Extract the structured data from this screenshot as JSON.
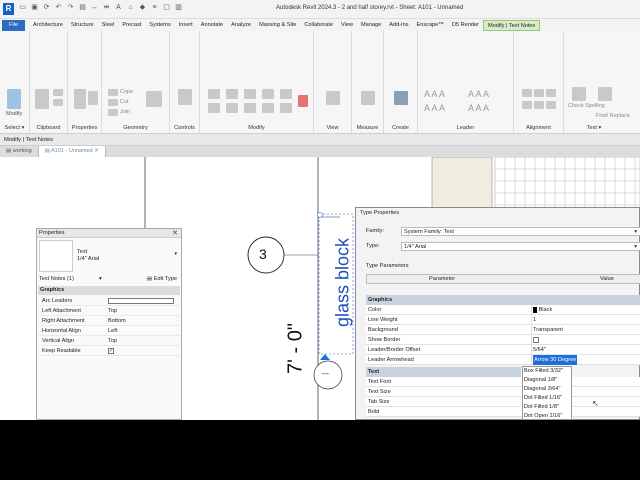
{
  "window": {
    "app_logo": "R",
    "title": "Autodesk Revit 2024.3 - 2 and half storey.rvt - Sheet: A101 - Unnamed"
  },
  "ribbon_tabs": [
    "File",
    "Architecture",
    "Structure",
    "Steel",
    "Precast",
    "Systems",
    "Insert",
    "Annotate",
    "Analyze",
    "Massing & Site",
    "Collaborate",
    "View",
    "Manage",
    "Add-Ins",
    "Enscape™",
    "D5 Render",
    "Modify | Text Notes"
  ],
  "ribbon_panels": [
    "Select",
    "Clipboard",
    "Properties",
    "Geometry",
    "Controls",
    "Modify",
    "View",
    "Measure",
    "Create",
    "Leader",
    "Alignment",
    "Text"
  ],
  "ribbon_small_labels": {
    "modify": "Modify",
    "cope": "Cope",
    "cut": "Cut",
    "join": "Join",
    "activate_controls": "Activate Controls",
    "check_spelling": "Check Spelling",
    "find_replace": "Find/ Replace"
  },
  "context_bar": "Modify | Text Notes",
  "doc_tabs": [
    "working",
    "A101 - Unnamed"
  ],
  "canvas": {
    "section_number": "3",
    "rotated_text": "glass block",
    "dimension": "7' - 0\"",
    "dash": "---"
  },
  "properties": {
    "title": "Properties",
    "type_family": "Text",
    "type_name": "1/4\" Arial",
    "instance_filter": "Text Notes (1)",
    "edit_type": "Edit Type",
    "group": "Graphics",
    "rows": [
      {
        "k": "Arc Leaders",
        "v": "",
        "checkbox": "empty"
      },
      {
        "k": "Left Attachment",
        "v": "Top"
      },
      {
        "k": "Right Attachment",
        "v": "Bottom"
      },
      {
        "k": "Horizontal Align",
        "v": "Left"
      },
      {
        "k": "Vertical Align",
        "v": "Top"
      },
      {
        "k": "Keep Readable",
        "v": "",
        "checkbox": "checked"
      }
    ]
  },
  "type_dialog": {
    "title": "Type Properties",
    "family_label": "Family:",
    "family_value": "System Family: Text",
    "type_label": "Type:",
    "type_value": "1/4\" Arial",
    "params_label": "Type Parameters",
    "col_param": "Parameter",
    "col_value": "Value",
    "groups": [
      {
        "name": "Graphics",
        "rows": [
          {
            "k": "Color",
            "v": "Black",
            "swatch": "#000000"
          },
          {
            "k": "Line Weight",
            "v": "1"
          },
          {
            "k": "Background",
            "v": "Transparent"
          },
          {
            "k": "Show Border",
            "v": "",
            "checkbox": "empty"
          },
          {
            "k": "Leader/Border Offset",
            "v": "5/64\""
          },
          {
            "k": "Leader Arrowhead",
            "v": "Arrow 30 Degree"
          }
        ]
      },
      {
        "name": "Text",
        "rows": [
          {
            "k": "Text Font",
            "v": ""
          },
          {
            "k": "Text Size",
            "v": ""
          },
          {
            "k": "Tab Size",
            "v": ""
          },
          {
            "k": "Bold",
            "v": ""
          }
        ]
      }
    ],
    "dropdown_options": [
      "Box Filled 3/32\"",
      "Diagonal 1/8\"",
      "Diagonal 3/64\"",
      "Dot Filled 1/16\"",
      "Dot Filled 1/8\"",
      "Dot Open 1/16\""
    ]
  }
}
